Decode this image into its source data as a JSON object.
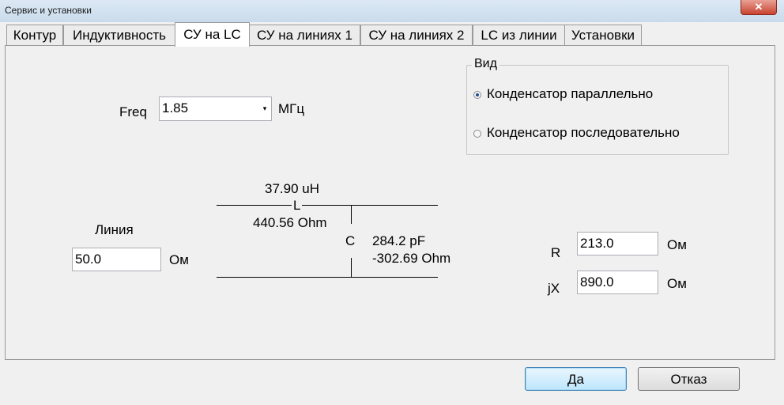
{
  "window": {
    "title": "Сервис и установки",
    "close_glyph": "✕"
  },
  "tabs": [
    {
      "label": "Контур"
    },
    {
      "label": "Индуктивность"
    },
    {
      "label": "СУ на LC",
      "active": true
    },
    {
      "label": "СУ на линиях 1"
    },
    {
      "label": "СУ на линиях 2"
    },
    {
      "label": "LC из линии"
    },
    {
      "label": "Установки"
    }
  ],
  "freq": {
    "label": "Freq",
    "value": "1.85",
    "unit": "МГц",
    "arrow": "▾"
  },
  "view": {
    "legend": "Вид",
    "options": [
      {
        "label": "Конденсатор параллельно",
        "selected": true
      },
      {
        "label": "Конденсатор последовательно",
        "selected": false
      }
    ]
  },
  "schematic": {
    "inductance": "37.90 uH",
    "l_label": "L",
    "l_reactance": "440.56 Ohm",
    "c_label": "C",
    "capacitance": "284.2 pF",
    "c_reactance": "-302.69 Ohm"
  },
  "line": {
    "label": "Линия",
    "value": "50.0",
    "unit": "Ом"
  },
  "load": {
    "r_label": "R",
    "r_value": "213.0",
    "r_unit": "Ом",
    "jx_label": "jX",
    "jx_value": "890.0",
    "jx_unit": "Ом"
  },
  "buttons": {
    "ok": "Да",
    "cancel": "Отказ"
  }
}
